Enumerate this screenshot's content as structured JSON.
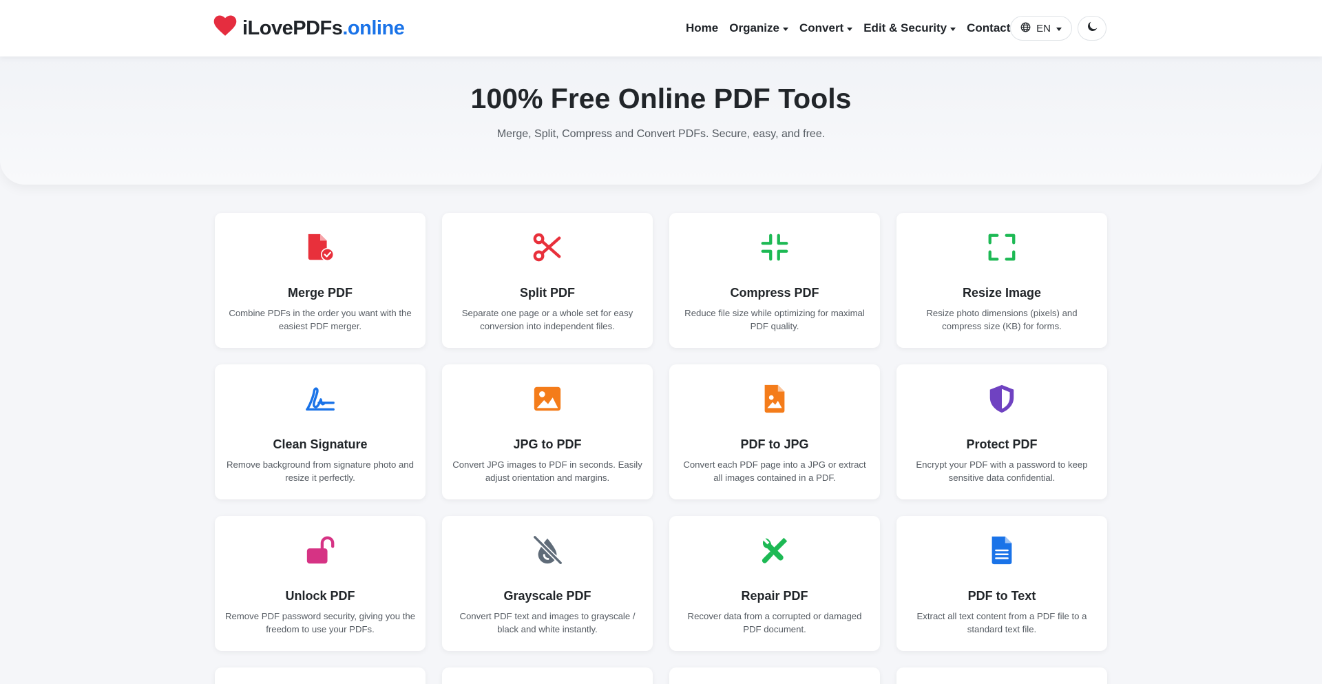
{
  "brand": {
    "name": "iLovePDFs",
    "tld": ".online",
    "accent_color": "#1a73e8",
    "icon": "heart-icon"
  },
  "nav": {
    "links": [
      {
        "label": "Home",
        "dropdown": false
      },
      {
        "label": "Organize",
        "dropdown": true
      },
      {
        "label": "Convert",
        "dropdown": true
      },
      {
        "label": "Edit & Security",
        "dropdown": true
      },
      {
        "label": "Contact",
        "dropdown": false
      }
    ],
    "language": {
      "label": "EN",
      "icon": "globe-icon"
    },
    "theme_toggle_icon": "moon-icon"
  },
  "hero": {
    "title": "100% Free Online PDF Tools",
    "subtitle": "Merge, Split, Compress and Convert PDFs. Secure, easy, and free."
  },
  "tools": [
    {
      "title": "Merge PDF",
      "desc": "Combine PDFs in the order you want with the easiest PDF merger.",
      "icon": "file-check-icon",
      "color": "#e8303b"
    },
    {
      "title": "Split PDF",
      "desc": "Separate one page or a whole set for easy conversion into independent files.",
      "icon": "scissors-icon",
      "color": "#e8303b"
    },
    {
      "title": "Compress PDF",
      "desc": "Reduce file size while optimizing for maximal PDF quality.",
      "icon": "compress-icon",
      "color": "#1db954"
    },
    {
      "title": "Resize Image",
      "desc": "Resize photo dimensions (pixels) and compress size (KB) for forms.",
      "icon": "expand-icon",
      "color": "#1db954"
    },
    {
      "title": "Clean Signature",
      "desc": "Remove background from signature photo and resize it perfectly.",
      "icon": "signature-icon",
      "color": "#1a73e8"
    },
    {
      "title": "JPG to PDF",
      "desc": "Convert JPG images to PDF in seconds. Easily adjust orientation and margins.",
      "icon": "image-icon",
      "color": "#f47c1a"
    },
    {
      "title": "PDF to JPG",
      "desc": "Convert each PDF page into a JPG or extract all images contained in a PDF.",
      "icon": "file-image-icon",
      "color": "#f47c1a"
    },
    {
      "title": "Protect PDF",
      "desc": "Encrypt your PDF with a password to keep sensitive data confidential.",
      "icon": "shield-icon",
      "color": "#6f42c1"
    },
    {
      "title": "Unlock PDF",
      "desc": "Remove PDF password security, giving you the freedom to use your PDFs.",
      "icon": "unlock-icon",
      "color": "#d63384"
    },
    {
      "title": "Grayscale PDF",
      "desc": "Convert PDF text and images to grayscale / black and white instantly.",
      "icon": "droplet-slash-icon",
      "color": "#5f6b78"
    },
    {
      "title": "Repair PDF",
      "desc": "Recover data from a corrupted or damaged PDF document.",
      "icon": "tools-icon",
      "color": "#1db954"
    },
    {
      "title": "PDF to Text",
      "desc": "Extract all text content from a PDF file to a standard text file.",
      "icon": "file-text-icon",
      "color": "#1a73e8"
    }
  ]
}
